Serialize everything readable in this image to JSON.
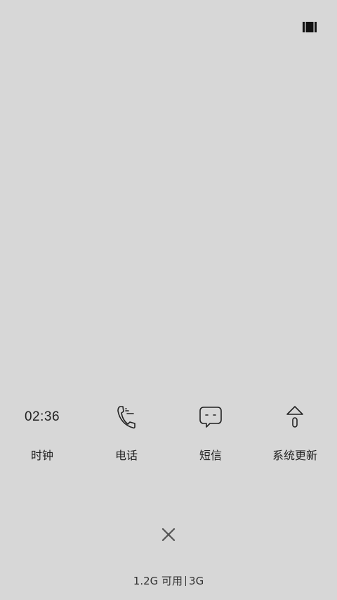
{
  "recents_icon": "panel-toggle-icon",
  "apps": [
    {
      "label": "时钟",
      "time": "02:36"
    },
    {
      "label": "电话",
      "icon": "phone-icon"
    },
    {
      "label": "短信",
      "icon": "message-bubble-icon"
    },
    {
      "label": "系统更新",
      "icon": "system-update-icon"
    }
  ],
  "close_icon": "close-icon",
  "memory": {
    "available": "1.2G 可用",
    "total": "3G"
  }
}
